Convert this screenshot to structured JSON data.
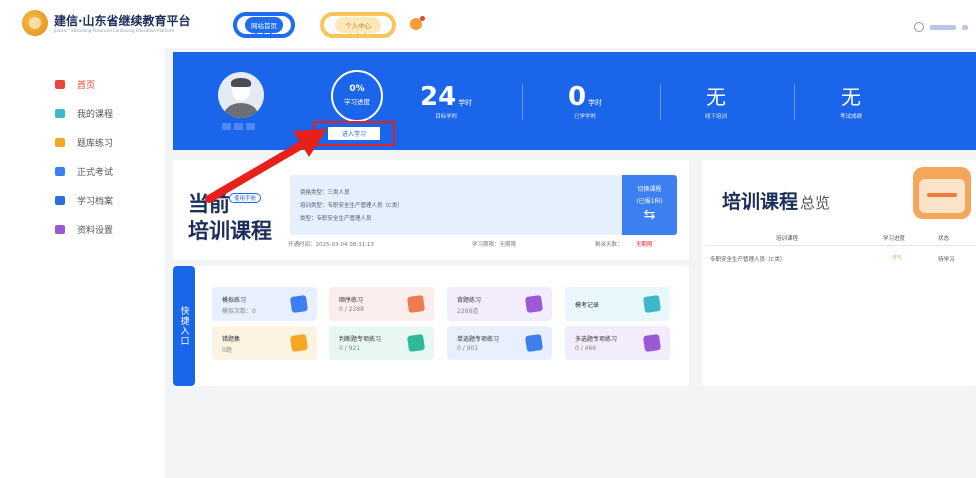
{
  "header": {
    "logo_title": "建信·山东省继续教育平台",
    "logo_subtitle": "Jianxin · Shandong Provincial Continuing Education Platform",
    "nav_home": "网站首页",
    "nav_center": "个人中心"
  },
  "sidebar": {
    "items": [
      {
        "label": "首页",
        "icon": "home-icon",
        "color": "#e8473a"
      },
      {
        "label": "我的课程",
        "icon": "book-icon",
        "color": "#3fb6c9"
      },
      {
        "label": "题库练习",
        "icon": "practice-icon",
        "color": "#f5a623"
      },
      {
        "label": "正式考试",
        "icon": "exam-icon",
        "color": "#3b7ff0"
      },
      {
        "label": "学习档案",
        "icon": "archive-icon",
        "color": "#2a6ee0"
      },
      {
        "label": "资料设置",
        "icon": "settings-icon",
        "color": "#9b59d6"
      }
    ]
  },
  "banner": {
    "progress_value": "0%",
    "progress_label": "学习进度",
    "enter_button": "进入学习",
    "stats": [
      {
        "value": "24",
        "unit": "学时",
        "label": "目标学时"
      },
      {
        "value": "0",
        "unit": "学时",
        "label": "已学学时"
      },
      {
        "value": "无",
        "unit": "",
        "label": "线下培训"
      },
      {
        "value": "无",
        "unit": "",
        "label": "考试成绩"
      }
    ]
  },
  "current": {
    "heading_line1": "当前",
    "heading_line2": "培训课程",
    "manual_badge": "使用手册",
    "info_lines": [
      "资格类型：三类人员",
      "培训类型：专职安全生产管理人员（C类）",
      "类型：专职安全生产管理人员"
    ],
    "switch_label": "切换课程",
    "switch_sub": "(已报1科)",
    "switch_arrow": "⇆",
    "open_time": "开通时间：2025-03-04 08:31:13",
    "study_period": "学习期限：无期限",
    "days_left_label": "剩余天数：",
    "days_left_value": "无期限"
  },
  "quick": {
    "label": "快捷入口",
    "tiles": [
      {
        "title": "模拟练习",
        "sub": "模拟次数：0",
        "bg": "#e9f0fd",
        "icon_color": "#3b7ff0",
        "icon": "mock-practice-icon"
      },
      {
        "title": "顺序练习",
        "sub": "0 / 2288",
        "bg": "#fdeeee",
        "icon_color": "#f07a52",
        "icon": "sequential-practice-icon"
      },
      {
        "title": "背题练习",
        "sub": "2288道",
        "bg": "#f3ecfd",
        "icon_color": "#9b59d6",
        "icon": "memorize-practice-icon"
      },
      {
        "title": "模考记录",
        "sub": "",
        "bg": "#e8f7fa",
        "icon_color": "#3fb6c9",
        "icon": "mock-record-icon"
      },
      {
        "title": "错题集",
        "sub": "0题",
        "bg": "#fdf3e3",
        "icon_color": "#f5a623",
        "icon": "wrong-questions-icon"
      },
      {
        "title": "判断题专项练习",
        "sub": "0 / 921",
        "bg": "#e8f7f4",
        "icon_color": "#2fb99a",
        "icon": "judgment-practice-icon"
      },
      {
        "title": "单选题专项练习",
        "sub": "0 / 901",
        "bg": "#e9f0fd",
        "icon_color": "#3b7ff0",
        "icon": "single-choice-icon"
      },
      {
        "title": "多选题专项练习",
        "sub": "0 / 466",
        "bg": "#f3ecfd",
        "icon_color": "#9b59d6",
        "icon": "multi-choice-icon"
      }
    ]
  },
  "overview": {
    "title": "培训课程",
    "title_suffix": "总览",
    "columns": [
      "培训课程",
      "学习进度",
      "状态"
    ],
    "rows": [
      {
        "course": "专职安全生产管理人员（C类）",
        "progress": "0%",
        "status": "待学习"
      }
    ]
  }
}
